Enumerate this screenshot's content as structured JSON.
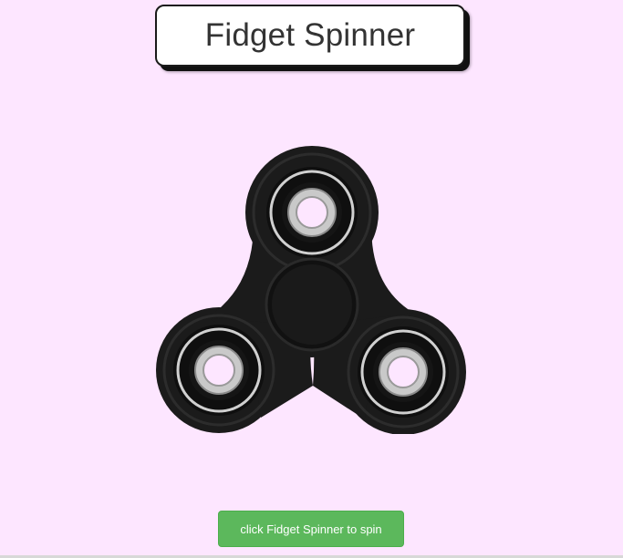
{
  "header": {
    "title": "Fidget Spinner"
  },
  "spinner": {
    "icon": "fidget-spinner-image",
    "body_color": "#1c1c1c",
    "bearing_ring_color": "#c8c8c8"
  },
  "button": {
    "label": "click Fidget Spinner to spin",
    "color": "#5cb85c"
  },
  "colors": {
    "background": "#fde6ff"
  }
}
